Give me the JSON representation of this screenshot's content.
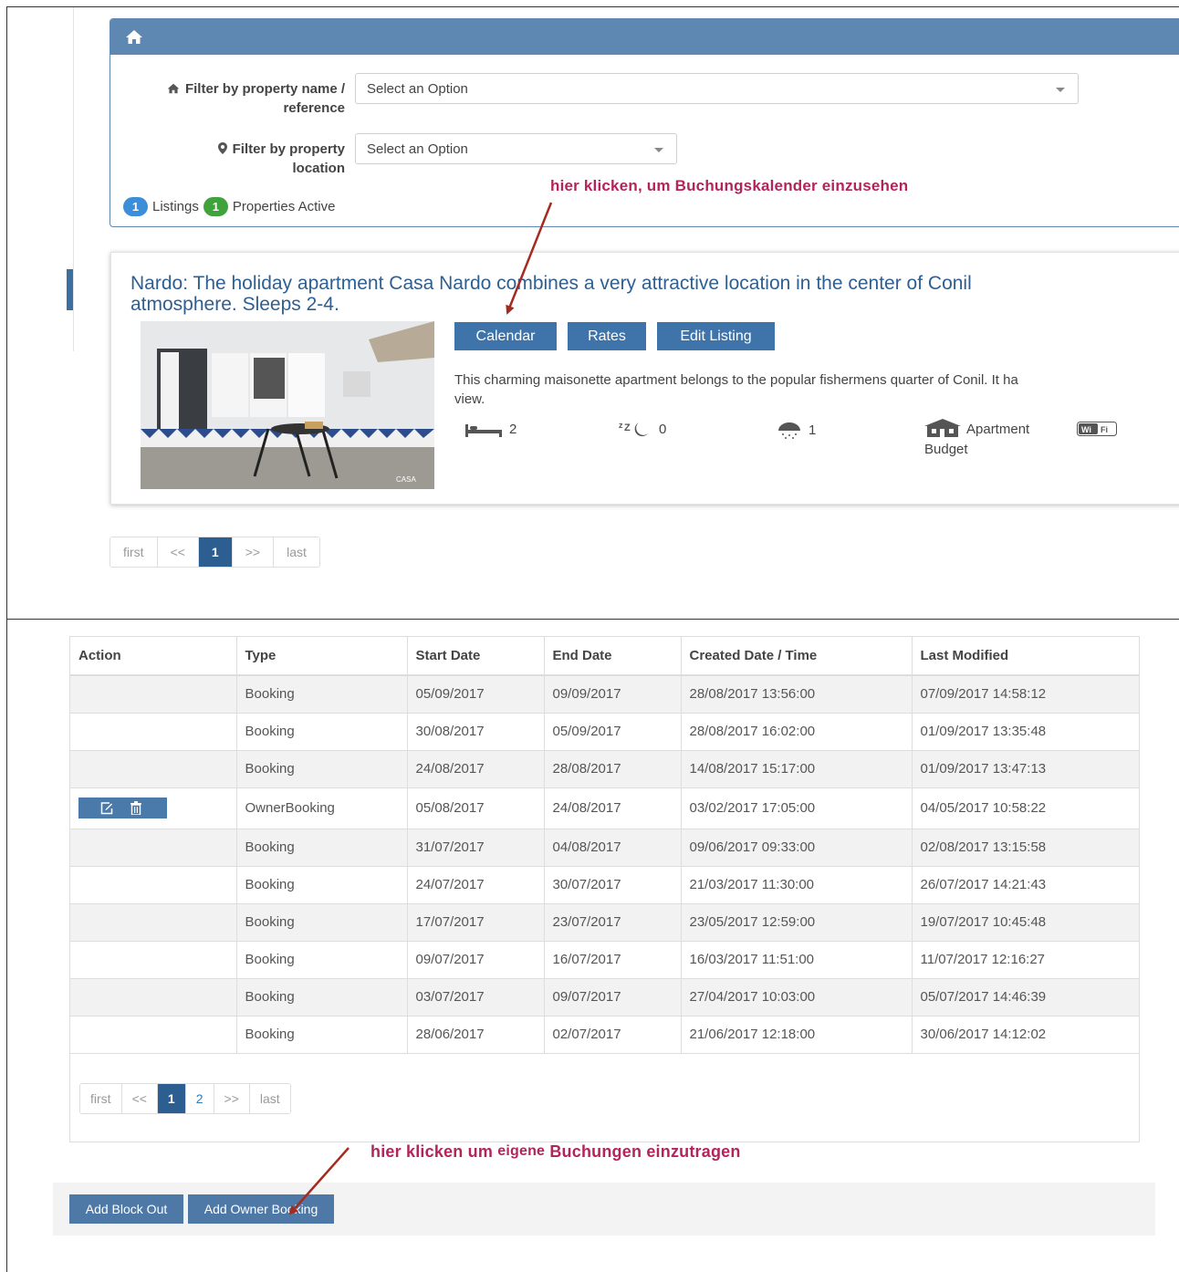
{
  "filter_panel": {
    "property_label_line1": "Filter by property name /",
    "property_label_line2": "reference",
    "property_select": "Select an Option",
    "location_label_line1": "Filter by property",
    "location_label_line2": "location",
    "location_select": "Select an Option",
    "listings_count": "1",
    "listings_label": "Listings",
    "active_count": "1",
    "active_label": "Properties Active"
  },
  "annotations": {
    "calendar_hint": "hier klicken, um Buchungskalender einzusehen",
    "owner_booking_hint_a": "hier klicken um",
    "owner_booking_hint_b": "eigene",
    "owner_booking_hint_c": "Buchungen einzutragen"
  },
  "listing": {
    "title_line1": "Nardo: The holiday apartment Casa Nardo combines a very attractive location in the center of Conil ",
    "title_line2": "atmosphere. Sleeps 2-4.",
    "buttons": {
      "calendar": "Calendar",
      "rates": "Rates",
      "edit": "Edit Listing"
    },
    "description_line1": "This charming maisonette apartment belongs to the popular fishermens quarter of Conil. It ha",
    "description_line2": "view.",
    "bedrooms": "2",
    "sleep": "0",
    "bathrooms": "1",
    "type": "Apartment",
    "category": "Budget",
    "photo_watermark": "CASA"
  },
  "listing_pager": {
    "first": "first",
    "prev": "<<",
    "current": "1",
    "next": ">>",
    "last": "last"
  },
  "bookings_table": {
    "headers": [
      "Action",
      "Type",
      "Start Date",
      "End Date",
      "Created Date / Time",
      "Last Modified"
    ],
    "rows": [
      {
        "type": "Booking",
        "start": "05/09/2017",
        "end": "09/09/2017",
        "created": "28/08/2017 13:56:00",
        "modified": "07/09/2017 14:58:12"
      },
      {
        "type": "Booking",
        "start": "30/08/2017",
        "end": "05/09/2017",
        "created": "28/08/2017 16:02:00",
        "modified": "01/09/2017 13:35:48"
      },
      {
        "type": "Booking",
        "start": "24/08/2017",
        "end": "28/08/2017",
        "created": "14/08/2017 15:17:00",
        "modified": "01/09/2017 13:47:13"
      },
      {
        "type": "OwnerBooking",
        "start": "05/08/2017",
        "end": "24/08/2017",
        "created": "03/02/2017 17:05:00",
        "modified": "04/05/2017 10:58:22"
      },
      {
        "type": "Booking",
        "start": "31/07/2017",
        "end": "04/08/2017",
        "created": "09/06/2017 09:33:00",
        "modified": "02/08/2017 13:15:58"
      },
      {
        "type": "Booking",
        "start": "24/07/2017",
        "end": "30/07/2017",
        "created": "21/03/2017 11:30:00",
        "modified": "26/07/2017 14:21:43"
      },
      {
        "type": "Booking",
        "start": "17/07/2017",
        "end": "23/07/2017",
        "created": "23/05/2017 12:59:00",
        "modified": "19/07/2017 10:45:48"
      },
      {
        "type": "Booking",
        "start": "09/07/2017",
        "end": "16/07/2017",
        "created": "16/03/2017 11:51:00",
        "modified": "11/07/2017 12:16:27"
      },
      {
        "type": "Booking",
        "start": "03/07/2017",
        "end": "09/07/2017",
        "created": "27/04/2017 10:03:00",
        "modified": "05/07/2017 14:46:39"
      },
      {
        "type": "Booking",
        "start": "28/06/2017",
        "end": "02/07/2017",
        "created": "21/06/2017 12:18:00",
        "modified": "30/06/2017 14:12:02"
      }
    ]
  },
  "table_pager": {
    "first": "first",
    "prev": "<<",
    "p1": "1",
    "p2": "2",
    "next": ">>",
    "last": "last"
  },
  "footer": {
    "add_block_out": "Add Block Out",
    "add_owner_booking": "Add Owner Booking"
  },
  "colors": {
    "accent": "#5e87b1",
    "button": "#3e74aa",
    "annotation": "#b3245a",
    "arrow": "#a52a1f"
  },
  "icons": [
    "home-icon",
    "map-pin-icon",
    "bed-icon",
    "sleep-icon",
    "shower-icon",
    "building-icon",
    "wifi-icon",
    "edit-icon",
    "trash-icon"
  ]
}
